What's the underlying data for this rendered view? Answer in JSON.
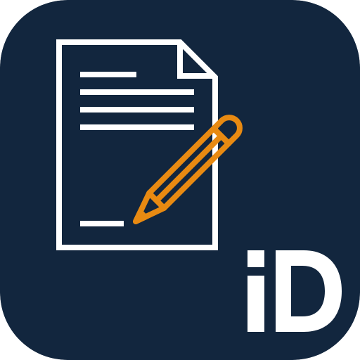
{
  "app_icon": {
    "name": "document-signing-app-icon",
    "badge_text": "iD",
    "colors": {
      "background": "#12263E",
      "document_stroke": "#FFFFFF",
      "pencil_stroke": "#E88A12",
      "badge_text": "#FFFFFF"
    },
    "icons": {
      "document": "document-icon",
      "pencil": "pencil-icon",
      "badge": "id-badge-icon"
    }
  }
}
